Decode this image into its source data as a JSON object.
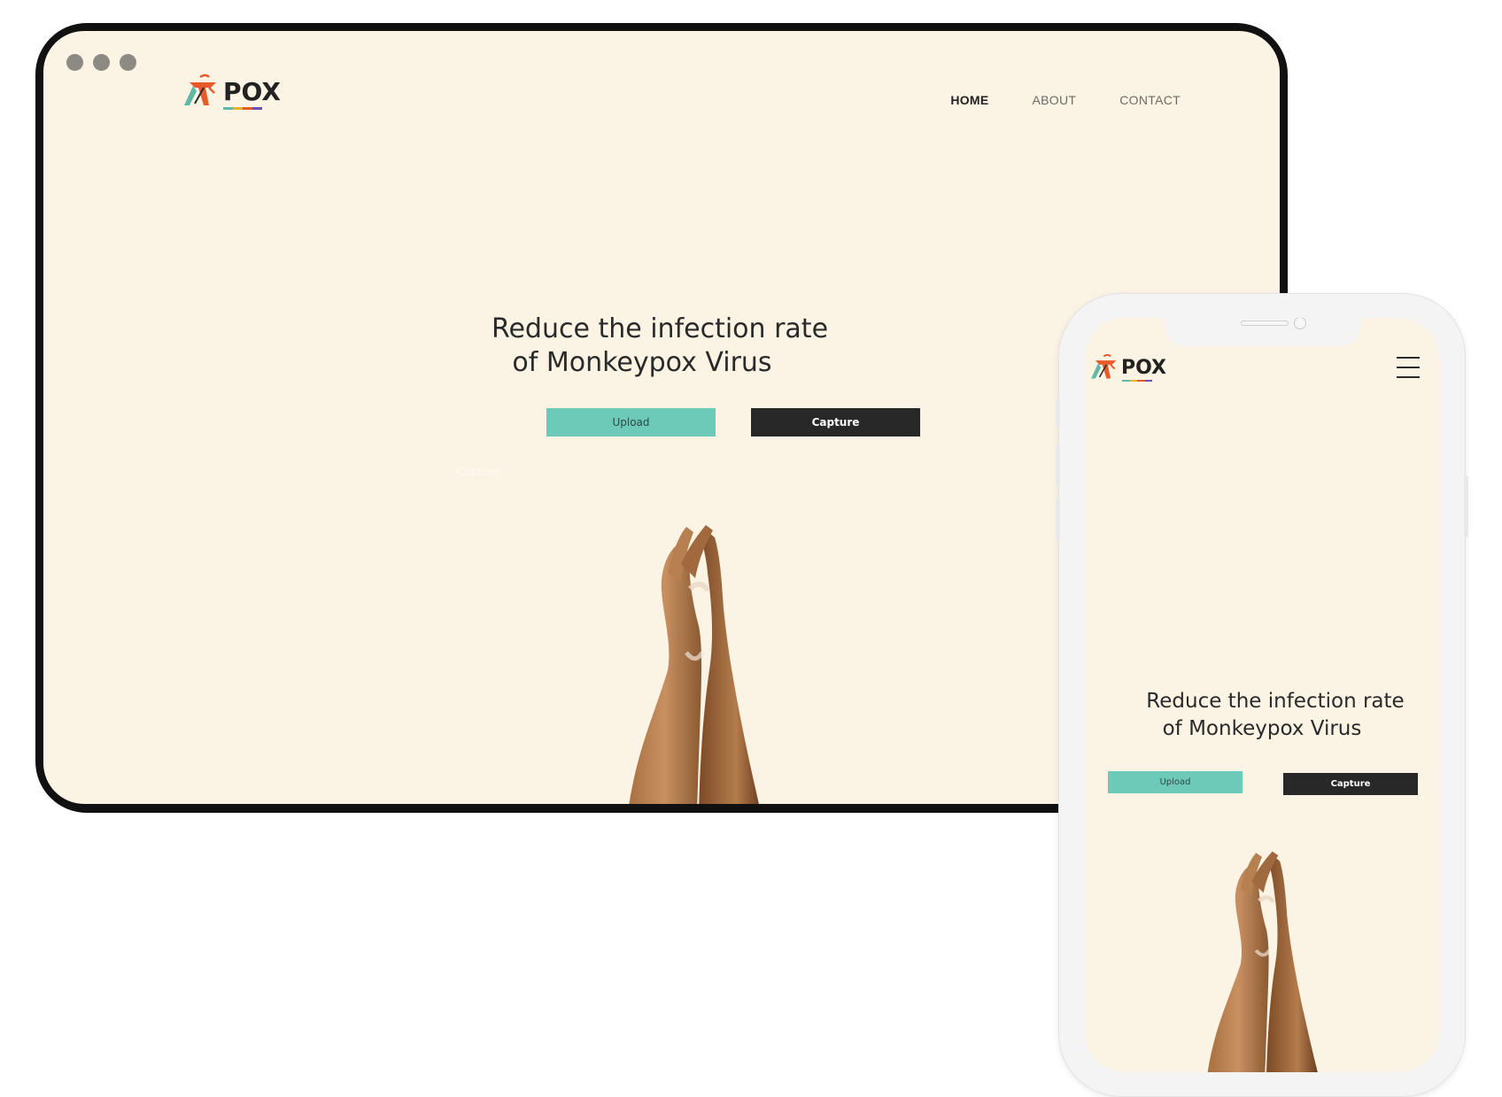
{
  "brand": {
    "name": "POX"
  },
  "nav": {
    "items": [
      {
        "label": "HOME",
        "active": true
      },
      {
        "label": "ABOUT",
        "active": false
      },
      {
        "label": "CONTACT",
        "active": false
      }
    ]
  },
  "hero": {
    "title_line1": "Reduce the infection rate",
    "title_line2": "of  Monkeypox Virus",
    "upload_label": "Upload",
    "capture_label": "Capture",
    "ghost_label": "Capture"
  },
  "colors": {
    "page_bg": "#fbf3e4",
    "upload_bg": "#6ecab8",
    "capture_bg": "#282828",
    "logo_accent": "#e85a2a"
  },
  "icons": [
    "window-dot-icon",
    "monkey-logo-icon",
    "hamburger-menu-icon"
  ]
}
